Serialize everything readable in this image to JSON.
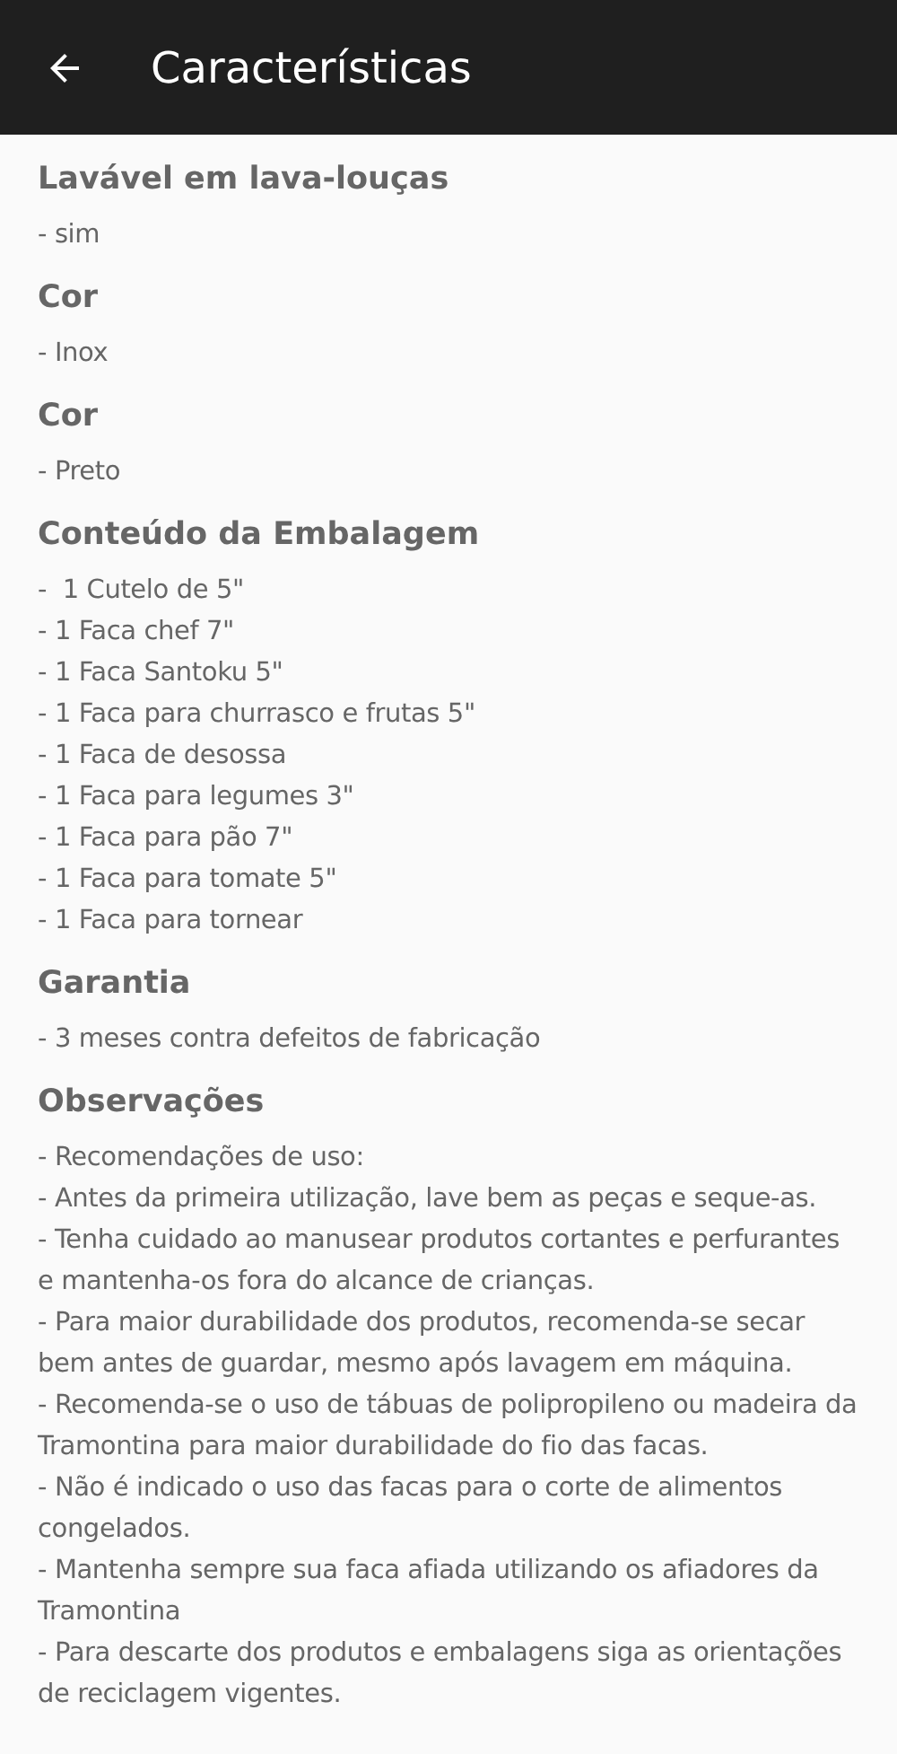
{
  "app_bar": {
    "title": "Características"
  },
  "sections": [
    {
      "heading": "Lavável em lava-louças",
      "lines": [
        "- sim"
      ]
    },
    {
      "heading": "Cor",
      "lines": [
        "- Inox"
      ]
    },
    {
      "heading": "Cor",
      "lines": [
        "- Preto"
      ]
    },
    {
      "heading": "Conteúdo da Embalagem",
      "lines": [
        "-  1 Cutelo de 5\"",
        "- 1 Faca chef 7\"",
        "- 1 Faca Santoku 5\"",
        "- 1 Faca para churrasco e frutas 5\"",
        "- 1 Faca de desossa",
        "- 1 Faca para legumes 3\"",
        "- 1 Faca para pão 7\"",
        "- 1 Faca para tomate 5\"",
        "- 1 Faca para tornear"
      ]
    },
    {
      "heading": "Garantia",
      "lines": [
        "- 3 meses contra defeitos de fabricação"
      ]
    },
    {
      "heading": "Observações",
      "lines": [
        "- Recomendações de uso:",
        "- Antes da primeira utilização, lave bem as peças e seque-as.",
        "- Tenha cuidado ao manusear produtos cortantes e perfurantes e mantenha-os fora do alcance de crianças.",
        "- Para maior durabilidade dos produtos, recomenda-se secar bem antes de guardar, mesmo após lavagem em máquina.",
        "- Recomenda-se o uso de tábuas de polipropileno ou madeira da Tramontina para maior durabilidade do fio das facas.",
        "- Não é indicado o uso das facas para o corte de alimentos congelados.",
        "- Mantenha sempre sua faca afiada utilizando os afiadores da Tramontina",
        "- Para descarte dos produtos e embalagens siga as orientações de reciclagem vigentes."
      ]
    }
  ]
}
